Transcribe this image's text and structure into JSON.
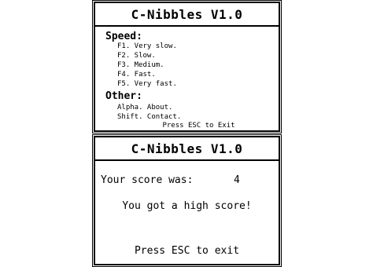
{
  "menu_screen": {
    "title": "C-Nibbles V1.0",
    "speed_heading": "Speed:",
    "speed_items": [
      "F1. Very slow.",
      "F2. Slow.",
      "F3. Medium.",
      "F4. Fast.",
      "F5. Very fast."
    ],
    "other_heading": "Other:",
    "other_items": [
      "Alpha. About.",
      "Shift. Contact."
    ],
    "exit_hint": "Press ESC to Exit"
  },
  "score_screen": {
    "title": "C-Nibbles V1.0",
    "score_label": "Your score was:",
    "score_value": "4",
    "high_score_message": "You got a high score!",
    "exit_hint": "Press ESC to exit"
  },
  "colors": {
    "foreground": "#000000",
    "background": "#ffffff"
  }
}
